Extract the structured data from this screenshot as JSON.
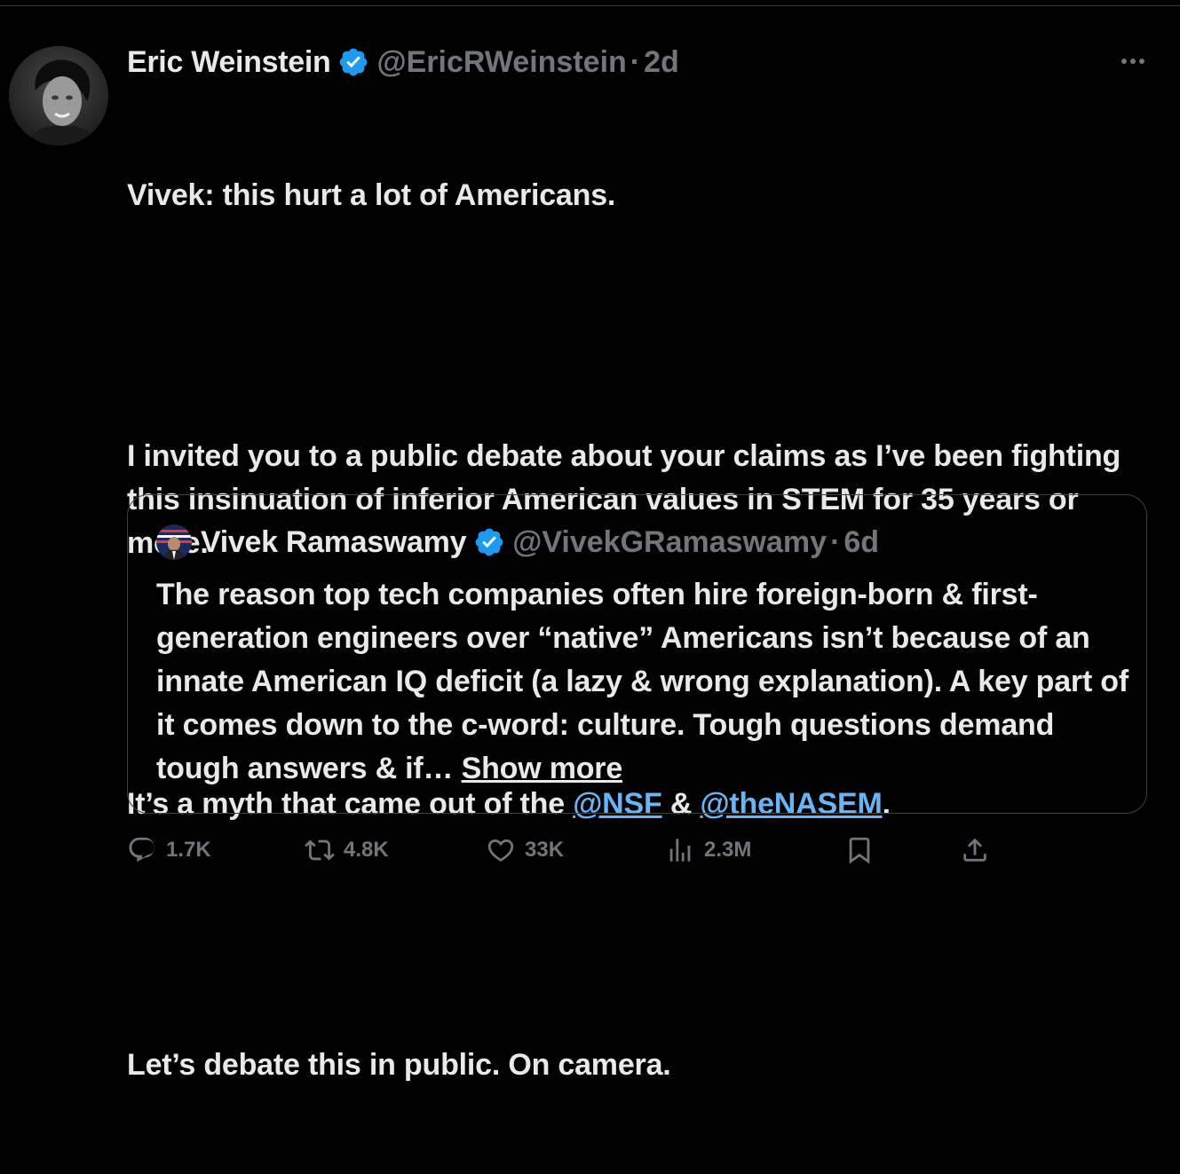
{
  "tweet": {
    "author_name": "Eric Weinstein",
    "handle": "@EricRWeinstein",
    "separator": "·",
    "time": "2d",
    "line1": "Vivek: this hurt a lot of Americans.",
    "para2": "I invited you to a public debate about your claims as I’ve been fighting this insinuation of inferior American values in STEM for 35 years or more.",
    "para3_pre": "It’s a myth that came out of the ",
    "mention1": "@NSF",
    "para3_mid": " & ",
    "mention2": "@theNASEM",
    "para3_post": ".",
    "para4": "Let’s debate this in public. On camera."
  },
  "quote": {
    "author_name": "Vivek Ramaswamy",
    "handle": "@VivekGRamaswamy",
    "separator": "·",
    "time": "6d",
    "text": "The reason top tech companies often hire foreign-born & first-generation engineers over “native” Americans isn’t because of an innate American IQ deficit (a lazy & wrong explanation). A key part of it comes down to the c-word: culture. Tough questions demand tough answers & if… ",
    "show_more": "Show more"
  },
  "actions": {
    "replies": "1.7K",
    "reposts": "4.8K",
    "likes": "33K",
    "views": "2.3M"
  },
  "colors": {
    "background": "#000000",
    "text": "#e7e9ea",
    "muted": "#71767b",
    "accent": "#1d9bf0",
    "border": "#2f3336"
  },
  "icons": [
    "verified-badge-icon",
    "more-icon",
    "reply-icon",
    "repost-icon",
    "like-icon",
    "views-icon",
    "bookmark-icon",
    "share-icon"
  ]
}
